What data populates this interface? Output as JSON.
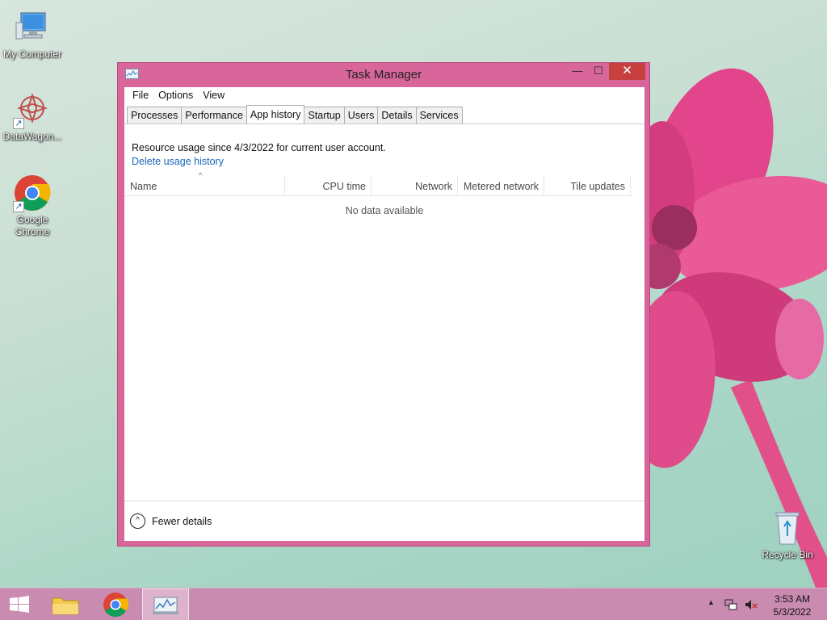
{
  "desktop": {
    "icons": [
      {
        "label": "My Computer"
      },
      {
        "label": "DataWagon..."
      },
      {
        "label": "Google Chrome"
      },
      {
        "label": "Recycle Bin"
      }
    ]
  },
  "window": {
    "title": "Task Manager",
    "controls": {
      "minimize": "—",
      "maximize": "☐",
      "close": "✕"
    },
    "menu": [
      "File",
      "Options",
      "View"
    ],
    "tabs": [
      "Processes",
      "Performance",
      "App history",
      "Startup",
      "Users",
      "Details",
      "Services"
    ],
    "active_tab": "App history",
    "info_text": "Resource usage since 4/3/2022 for current user account.",
    "delete_link": "Delete usage history",
    "columns": [
      "Name",
      "CPU time",
      "Network",
      "Metered network",
      "Tile updates"
    ],
    "sort_indicator": "^",
    "empty_text": "No data available",
    "fewer_details": "Fewer details",
    "fewer_icon": "^"
  },
  "taskbar": {
    "items": [
      "start-button",
      "file-explorer",
      "google-chrome",
      "task-manager"
    ],
    "active_item": "task-manager",
    "clock": {
      "time": "3:53 AM",
      "date": "5/3/2022"
    },
    "tray_overflow": "▲"
  },
  "colors": {
    "window_frame": "#d9669b",
    "close_button": "#c7403f",
    "taskbar": "#c98bb0",
    "link": "#1a64b8"
  }
}
